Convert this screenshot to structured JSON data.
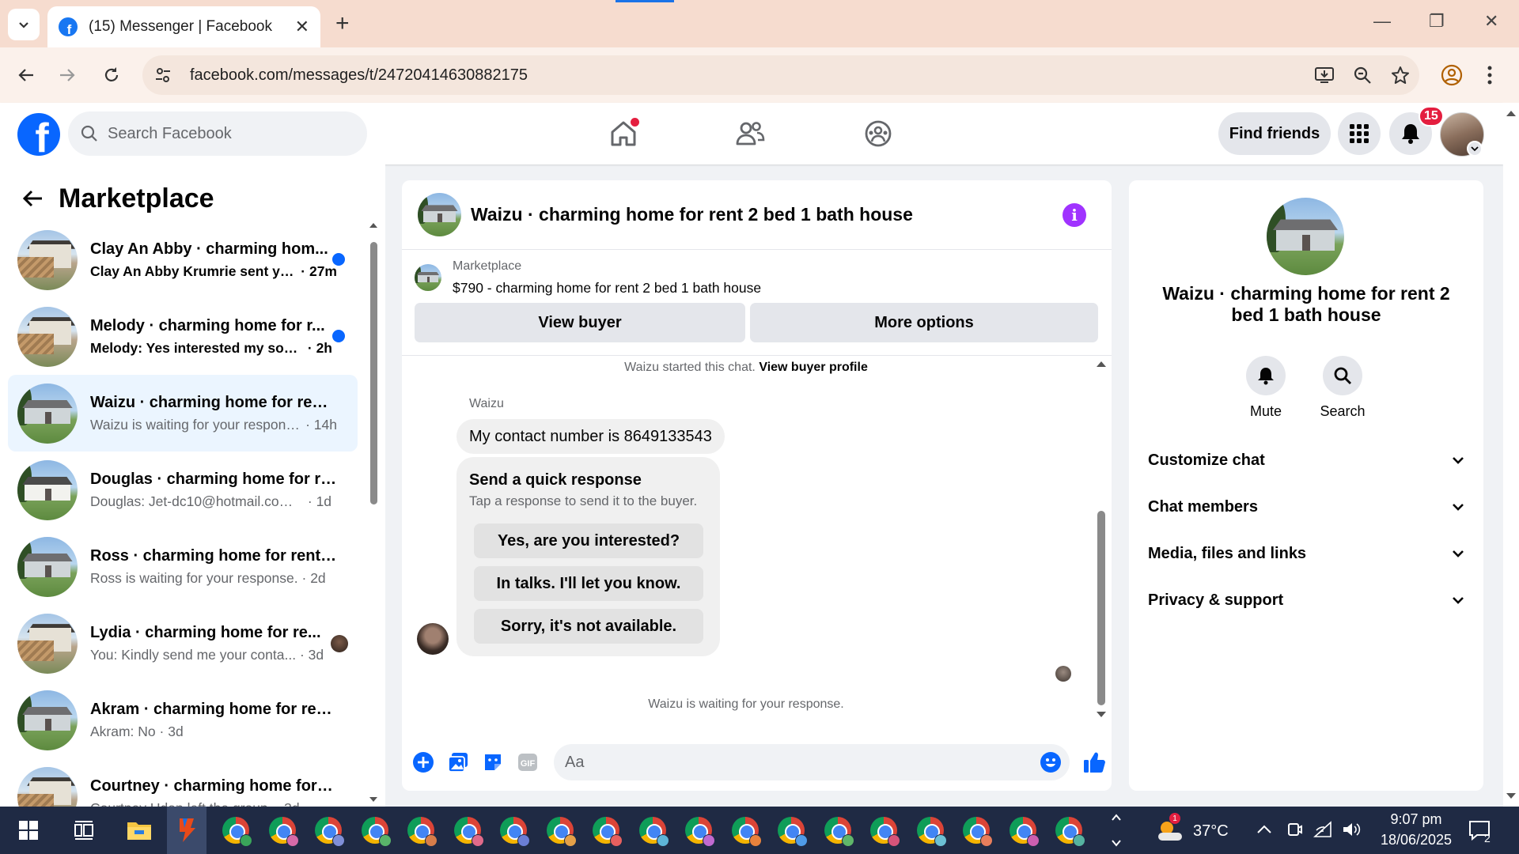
{
  "browser": {
    "tab_title": "(15) Messenger | Facebook",
    "tab_close": "✕",
    "new_tab": "+",
    "url": "facebook.com/messages/t/24720414630882175",
    "window_controls": {
      "minimize": "—",
      "restore": "❐",
      "close": "✕"
    }
  },
  "fb_header": {
    "logo_letter": "f",
    "search_placeholder": "Search Facebook",
    "find_friends": "Find friends",
    "notification_count": "15",
    "home_has_new": true
  },
  "sidebar": {
    "title": "Marketplace",
    "conversations": [
      {
        "name": "Clay An Abby · charming hom...",
        "preview": "Clay An Abby Krumrie sent yo...",
        "time": "27m",
        "unread": true,
        "thumb": "deck"
      },
      {
        "name": "Melody · charming home for r...",
        "preview": "Melody: Yes interested my son i...",
        "time": "2h",
        "unread": true,
        "thumb": "deck"
      },
      {
        "name": "Waizu · charming home for rent...",
        "preview": "Waizu is waiting for your response.",
        "time": "14h",
        "unread": false,
        "active": true,
        "thumb": "gray"
      },
      {
        "name": "Douglas · charming home for re...",
        "preview": "Douglas: Jet-dc10@hotmail.com (6...",
        "time": "1d",
        "unread": false,
        "thumb": "white"
      },
      {
        "name": "Ross · charming home for rent 2...",
        "preview": "Ross is waiting for your response.",
        "time": "2d",
        "unread": false,
        "thumb": "gray"
      },
      {
        "name": "Lydia · charming home for re...",
        "preview": "You: Kindly send me your conta...",
        "time": "3d",
        "unread": false,
        "thumb": "deck",
        "seen_avatar": true
      },
      {
        "name": "Akram · charming home for ren...",
        "preview": "Akram: No",
        "time": "3d",
        "unread": false,
        "thumb": "gray"
      },
      {
        "name": "Courtney · charming home for r...",
        "preview": "Courtney Udan left the group.",
        "time": "3d",
        "unread": false,
        "thumb": "deck"
      }
    ]
  },
  "chat": {
    "title": "Waizu · charming home for rent 2 bed 1 bath house",
    "listing_label": "Marketplace",
    "listing_price": "$790 - charming home for rent 2 bed 1 bath house",
    "view_buyer": "View buyer",
    "more_options": "More options",
    "started_text": "Waizu started this chat.",
    "view_buyer_profile": "View buyer profile",
    "sender": "Waizu",
    "message": "My contact number is 8649133543",
    "quick_title": "Send a quick response",
    "quick_sub": "Tap a response to send it to the buyer.",
    "quick_replies": [
      "Yes, are you interested?",
      "In talks. I'll let you know.",
      "Sorry, it's not available."
    ],
    "waiting_text": "Waizu is waiting for your response.",
    "composer_placeholder": "Aa",
    "gif_label": "GIF"
  },
  "info_panel": {
    "title": "Waizu · charming home for rent 2 bed 1 bath house",
    "mute": "Mute",
    "search": "Search",
    "sections": [
      "Customize chat",
      "Chat members",
      "Media, files and links",
      "Privacy & support"
    ]
  },
  "taskbar": {
    "temperature": "37°C",
    "time": "9:07 pm",
    "date": "18/06/2025",
    "notification_count": "2",
    "weather_alert": "1",
    "chrome_windows": 19
  },
  "colors": {
    "fb_blue": "#0866ff",
    "messenger_purple": "#a033ff",
    "unread_dot": "#0866ff",
    "badge_red": "#e41e3f",
    "active_conv": "#ebf5ff",
    "taskbar": "#1f2a44"
  }
}
